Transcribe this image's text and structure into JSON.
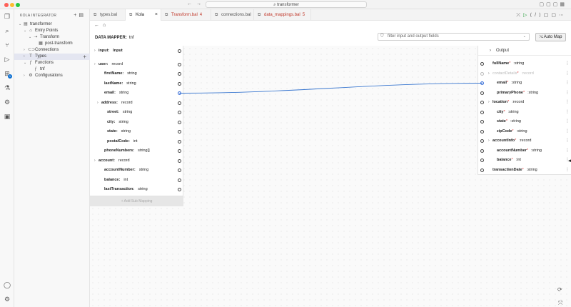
{
  "window": {
    "search_text": "transformer"
  },
  "explorer": {
    "header": "KOLA INTEGRATOR",
    "items": [
      {
        "label": "transformer",
        "indent": 0,
        "chevron": "⌄",
        "icon": "▤"
      },
      {
        "label": "Entry Points",
        "indent": 1,
        "chevron": "⌄",
        "icon": "⌂"
      },
      {
        "label": "Transform",
        "indent": 2,
        "chevron": "⌄",
        "icon": "⇢"
      },
      {
        "label": "post-transform",
        "indent": 3,
        "chevron": "",
        "icon": "▦"
      },
      {
        "label": "Connections",
        "indent": 1,
        "chevron": "›",
        "icon": "⊂⊃"
      },
      {
        "label": "Types",
        "indent": 1,
        "chevron": "›",
        "icon": "T"
      },
      {
        "label": "Functions",
        "indent": 1,
        "chevron": "⌄",
        "icon": "ƒ"
      },
      {
        "label": "tnf",
        "indent": 2,
        "chevron": "",
        "icon": "ƒ"
      },
      {
        "label": "Configurations",
        "indent": 1,
        "chevron": "›",
        "icon": "⚙"
      }
    ]
  },
  "tabs": [
    {
      "label": "types.bal",
      "modified": false,
      "active": false
    },
    {
      "label": "Kola",
      "modified": false,
      "active": true
    },
    {
      "label": "Transform.bal",
      "modified": true,
      "active": false,
      "count": "4"
    },
    {
      "label": "connections.bal",
      "modified": false,
      "active": false
    },
    {
      "label": "data_mappings.bal",
      "modified": true,
      "active": false,
      "count": "5"
    }
  ],
  "data_mapper": {
    "title": "DATA MAPPER:",
    "function_name": "tnf",
    "filter_placeholder": "filter input and output fields",
    "auto_map_label": "Auto Map",
    "add_sub_mapping_label": "Add Sub Mapping",
    "input_rows": [
      {
        "name": "input:",
        "type": "Input",
        "indent": 0,
        "chevron": true,
        "bold_type": true,
        "connected": false
      },
      {
        "name": "user:",
        "type": "record",
        "indent": 0,
        "chevron": true,
        "connected": false
      },
      {
        "name": "firstName:",
        "type": "string",
        "indent": 2,
        "connected": false
      },
      {
        "name": "lastName:",
        "type": "string",
        "indent": 2,
        "connected": false
      },
      {
        "name": "email:",
        "type": "string",
        "indent": 2,
        "connected": true
      },
      {
        "name": "address:",
        "type": "record",
        "indent": 1,
        "chevron": true,
        "connected": false
      },
      {
        "name": "street:",
        "type": "string",
        "indent": 3,
        "connected": false
      },
      {
        "name": "city:",
        "type": "string",
        "indent": 3,
        "connected": false
      },
      {
        "name": "state:",
        "type": "string",
        "indent": 3,
        "connected": false
      },
      {
        "name": "postalCode:",
        "type": "int",
        "indent": 3,
        "connected": false
      },
      {
        "name": "phoneNumbers:",
        "type": "string[]",
        "indent": 2,
        "connected": false
      },
      {
        "name": "account:",
        "type": "record",
        "indent": 0,
        "chevron": true,
        "connected": false
      },
      {
        "name": "accountNumber:",
        "type": "string",
        "indent": 2,
        "connected": false
      },
      {
        "name": "balance:",
        "type": "int",
        "indent": 2,
        "connected": false
      },
      {
        "name": "lastTransaction:",
        "type": "string",
        "indent": 2,
        "connected": false
      }
    ],
    "output_header": "Output",
    "output_rows": [
      {
        "name": "fullName",
        "type": "string",
        "indent": 1,
        "connected": false
      },
      {
        "name": "contactDetails",
        "type": "record",
        "indent": 1,
        "chevron": true,
        "disabled": true,
        "connected": false
      },
      {
        "name": "email",
        "type": "string",
        "indent": 2,
        "connected": true
      },
      {
        "name": "primaryPhone",
        "type": "string",
        "indent": 2,
        "connected": false
      },
      {
        "name": "location",
        "type": "record",
        "indent": 1,
        "chevron": true,
        "connected": false
      },
      {
        "name": "city",
        "type": "string",
        "indent": 2,
        "connected": false
      },
      {
        "name": "state",
        "type": "string",
        "indent": 2,
        "connected": false
      },
      {
        "name": "zipCode",
        "type": "string",
        "indent": 2,
        "connected": false
      },
      {
        "name": "accountInfo",
        "type": "record",
        "indent": 1,
        "chevron": true,
        "connected": false
      },
      {
        "name": "accountNumber",
        "type": "string",
        "indent": 2,
        "connected": false
      },
      {
        "name": "balance",
        "type": "int",
        "indent": 2,
        "connected": false
      },
      {
        "name": "transactionDate",
        "type": "string",
        "indent": 1,
        "connected": false
      }
    ]
  }
}
